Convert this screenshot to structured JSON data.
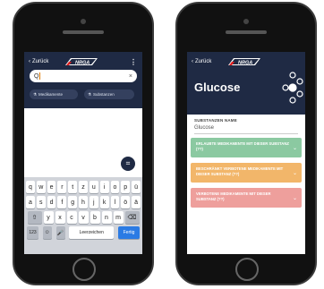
{
  "left_phone": {
    "nav": {
      "back_label": "Zurück",
      "logo_text": "NRGA"
    },
    "search": {
      "value": "Q",
      "clear_icon": "close-icon"
    },
    "chips": [
      {
        "icon": "flask-icon",
        "label": "Medikamente"
      },
      {
        "icon": "flask-icon",
        "label": "Substanzen"
      }
    ],
    "fab_icon": "grid-icon",
    "keyboard": {
      "row1": [
        "q",
        "w",
        "e",
        "r",
        "t",
        "z",
        "u",
        "i",
        "o",
        "p",
        "ü"
      ],
      "row2": [
        "a",
        "s",
        "d",
        "f",
        "g",
        "h",
        "j",
        "k",
        "l",
        "ö",
        "ä"
      ],
      "row3": [
        "⇧",
        "y",
        "x",
        "c",
        "v",
        "b",
        "n",
        "m",
        "⌫"
      ],
      "num_label": "123",
      "emoji_label": "☺",
      "mic_label": "🎤",
      "space_label": "Leerzeichen",
      "done_label": "Fertig"
    }
  },
  "right_phone": {
    "nav": {
      "back_label": "Zurück",
      "logo_text": "NRGA"
    },
    "title": "Glucose",
    "field": {
      "label": "SUBSTANZEN NAME",
      "value": "Glucose"
    },
    "sections": [
      {
        "label": "ERLAUBTE MEDIKAMENTE MIT DIESER SUBSTANZ (??)",
        "color": "#8bc9a1"
      },
      {
        "label": "BESCHRÄNKT VERBOTENE MEDIKAMENTE MIT DIESER SUBSTANZ (??)",
        "color": "#f2b66a"
      },
      {
        "label": "VERBOTENE MEDIKAMENTE MIT DIESER SUBSTANZ (??)",
        "color": "#ee9f9c"
      }
    ]
  }
}
